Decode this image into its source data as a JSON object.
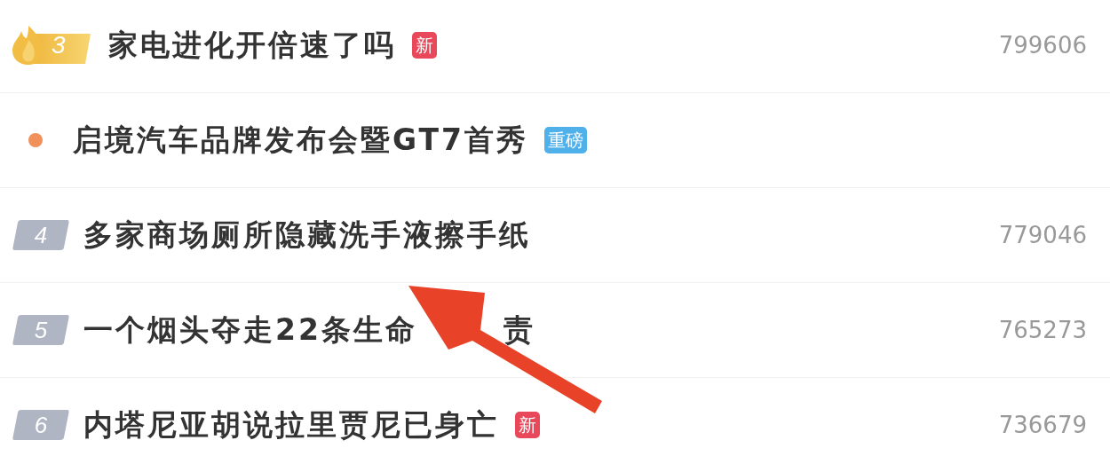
{
  "items": [
    {
      "kind": "hot",
      "rank": "3",
      "title": "家电进化开倍速了吗",
      "tag": {
        "text": "新",
        "color": "#e8485a"
      },
      "count": "799606"
    },
    {
      "kind": "promo",
      "title": "启境汽车品牌发布会暨GT7首秀",
      "tag": {
        "text": "重磅",
        "color": "#4fb0ea"
      }
    },
    {
      "kind": "rank",
      "rank": "4",
      "title": "多家商场厕所隐藏洗手液擦手纸",
      "count": "779046"
    },
    {
      "kind": "rank",
      "rank": "5",
      "title": "一个烟头夺走22条生命",
      "title_end": "责",
      "count": "765273"
    },
    {
      "kind": "rank",
      "rank": "6",
      "title": "内塔尼亚胡说拉里贾尼已身亡",
      "tag": {
        "text": "新",
        "color": "#e8485a"
      },
      "count": "736679"
    }
  ]
}
